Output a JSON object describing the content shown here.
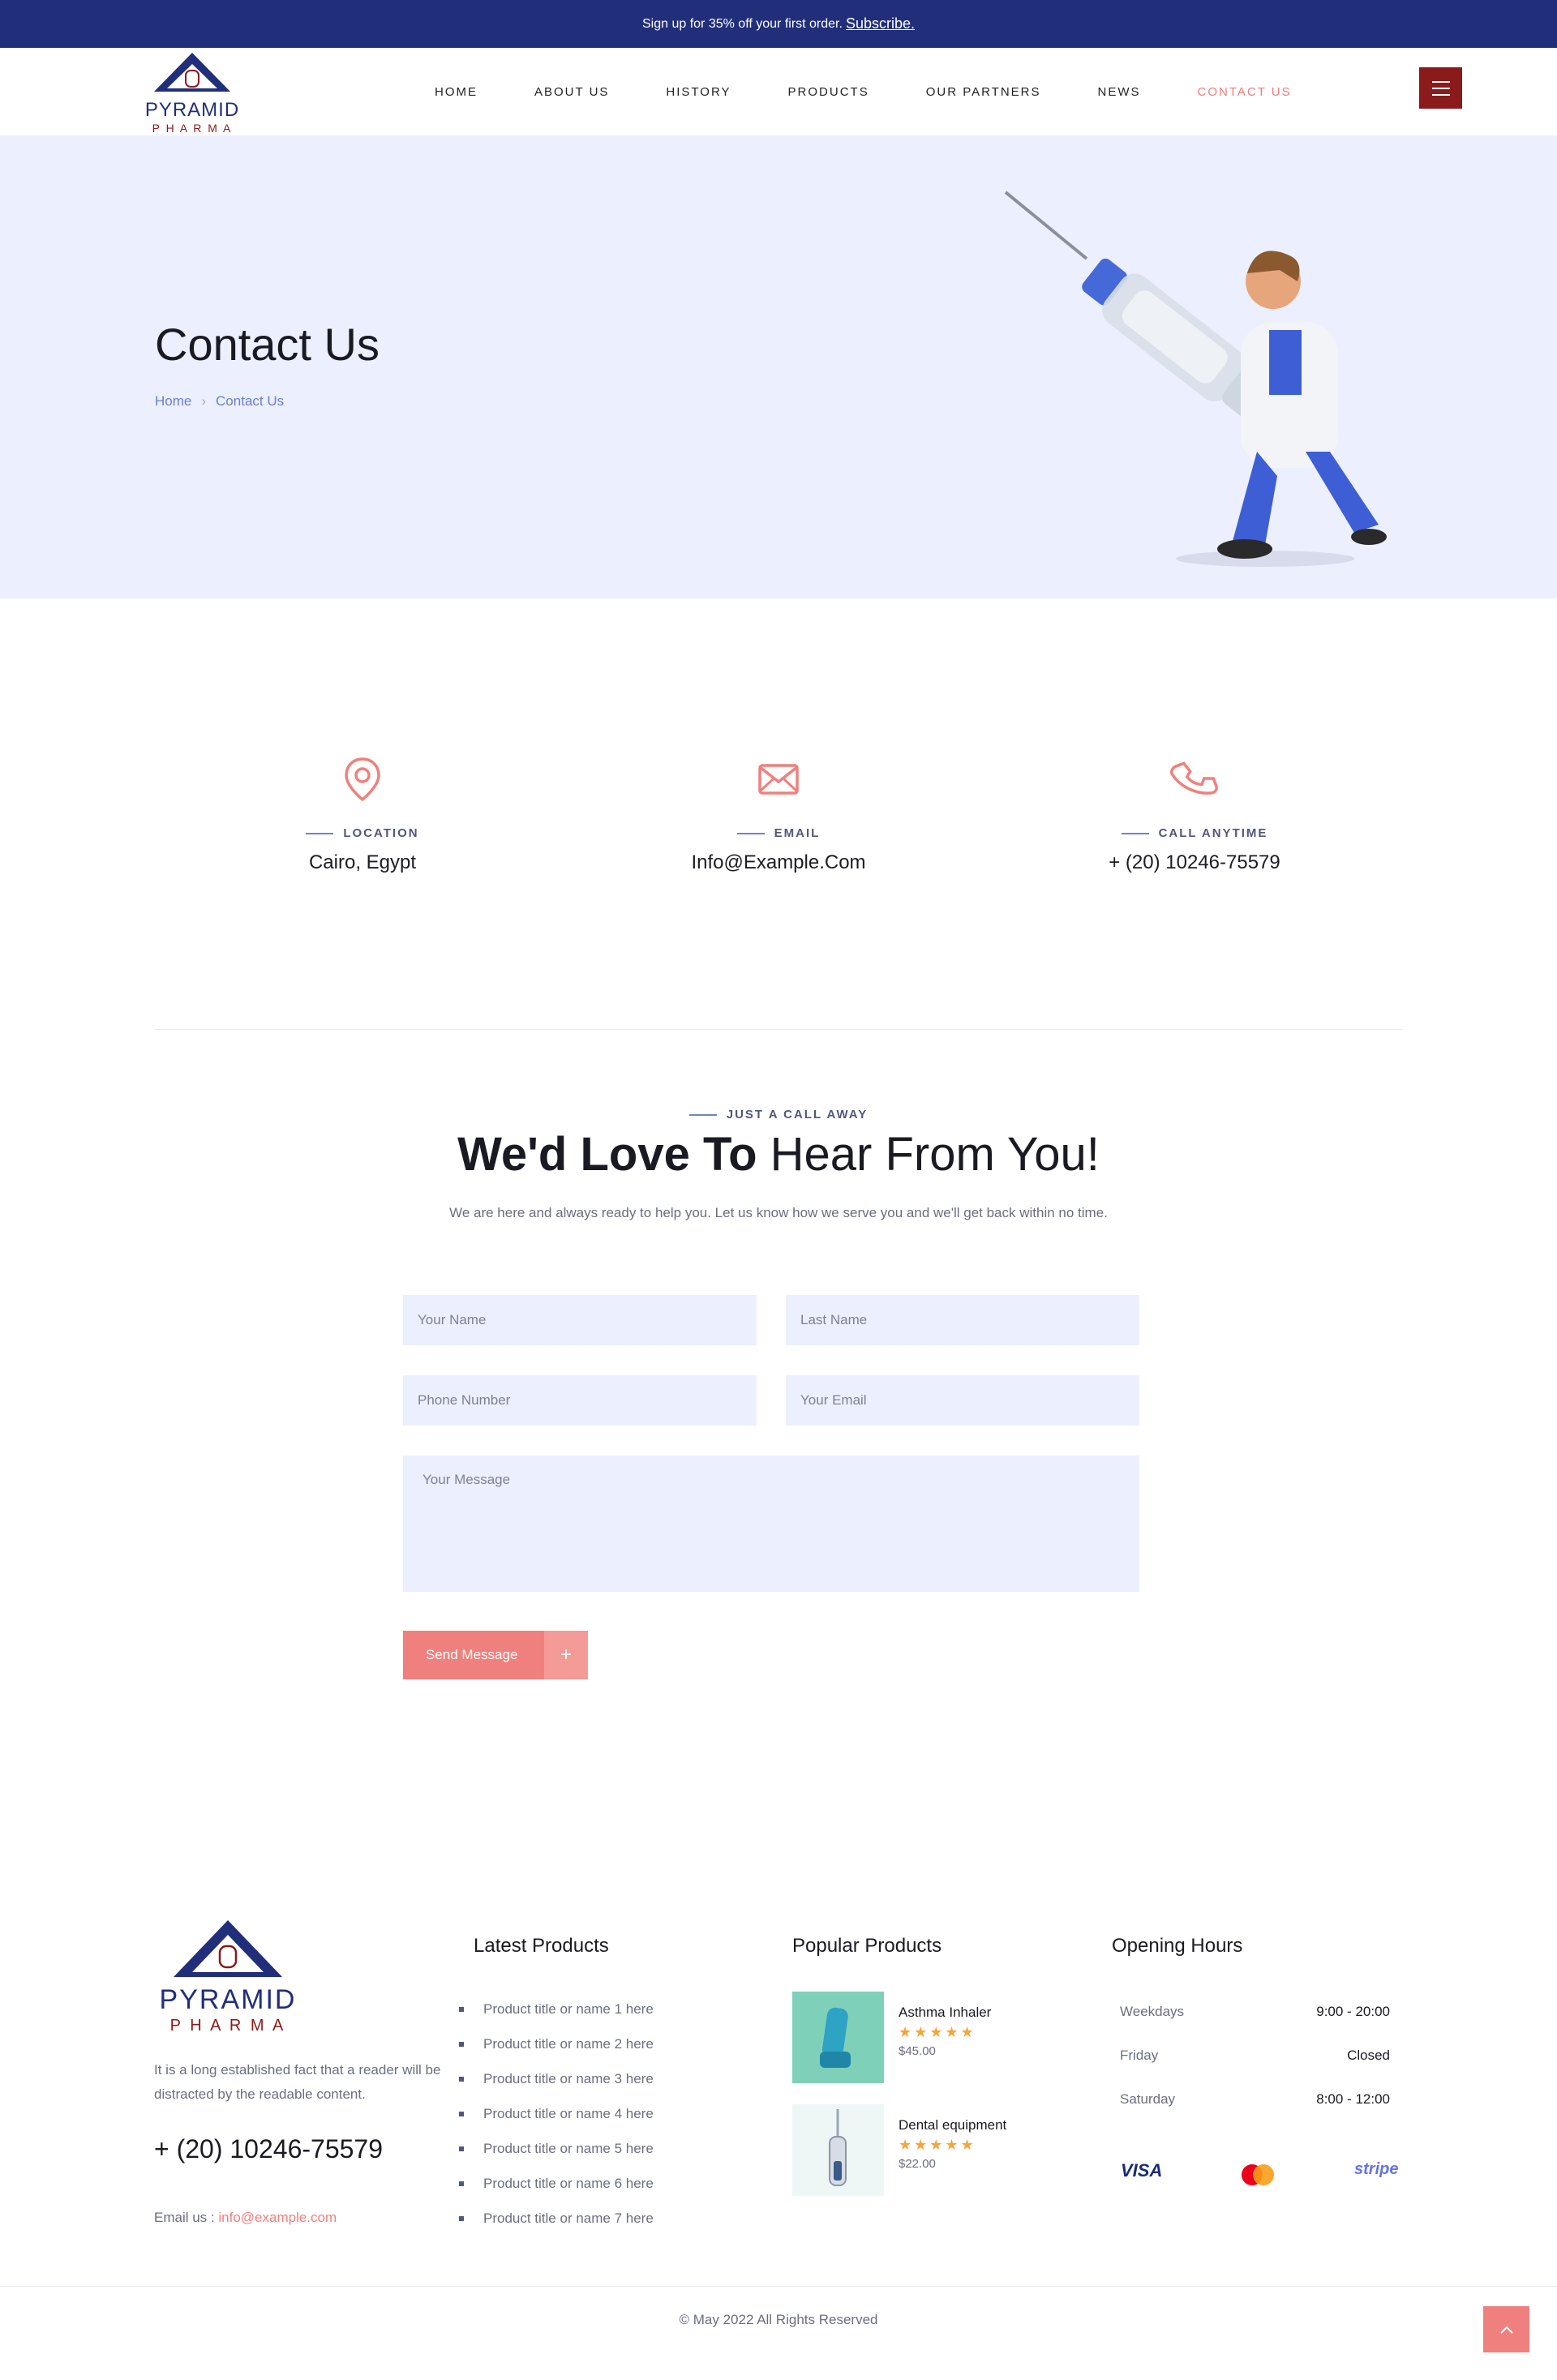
{
  "topbar": {
    "text": "Sign up for 35% off your first order.",
    "link": "Subscribe."
  },
  "brand": {
    "line1": "PYRAMID",
    "line2": "P H A R M A"
  },
  "nav": [
    {
      "label": "HOME"
    },
    {
      "label": "ABOUT US"
    },
    {
      "label": "HISTORY"
    },
    {
      "label": "PRODUCTS"
    },
    {
      "label": "OUR PARTNERS"
    },
    {
      "label": "NEWS"
    },
    {
      "label": "CONTACT US",
      "active": true
    }
  ],
  "hero": {
    "title": "Contact Us",
    "crumb_home": "Home",
    "crumb_current": "Contact Us"
  },
  "info": [
    {
      "icon": "location-pin-icon",
      "label": "LOCATION",
      "value": "Cairo, Egypt"
    },
    {
      "icon": "envelope-icon",
      "label": "EMAIL",
      "value": "Info@Example.Com"
    },
    {
      "icon": "phone-icon",
      "label": "CALL ANYTIME",
      "value": "+ (20) 10246-75579"
    }
  ],
  "contact": {
    "kicker": "JUST A CALL AWAY",
    "heading_bold": "We'd Love To",
    "heading_light": "Hear From You!",
    "subtext": "We are here and always ready to help you. Let us know how we serve you and we'll get back within no time.",
    "ph_first": "Your Name",
    "ph_last": "Last Name",
    "ph_phone": "Phone Number",
    "ph_email": "Your Email",
    "ph_message": "Your Message",
    "send": "Send Message",
    "send_plus": "+"
  },
  "footer": {
    "desc": "It is a long established fact that a reader will be distracted by the readable content.",
    "phone": "+ (20) 10246-75579",
    "email_label": "Email us :",
    "email": "info@example.com",
    "latest_title": "Latest Products",
    "latest": [
      "Product title or name 1 here",
      "Product title or name 2 here",
      "Product title or name 3 here",
      "Product title or name 4 here",
      "Product title or name 5 here",
      "Product title or name 6 here",
      "Product title or name 7 here"
    ],
    "popular_title": "Popular Products",
    "popular": [
      {
        "name": "Asthma Inhaler",
        "stars": "★★★★★",
        "price": "$45.00"
      },
      {
        "name": "Dental equipment",
        "stars": "★★★★★",
        "price": "$22.00"
      }
    ],
    "hours_title": "Opening Hours",
    "hours": [
      {
        "day": "Weekdays",
        "time": "9:00 - 20:00"
      },
      {
        "day": "Friday",
        "time": "Closed"
      },
      {
        "day": "Saturday",
        "time": "8:00 - 12:00"
      }
    ],
    "pay_visa": "VISA",
    "pay_stripe": "stripe",
    "copyright": "© May 2022 All Rights Reserved"
  },
  "colors": {
    "navy": "#212f7b",
    "accent": "#f0807d",
    "menu": "#8b1a1a",
    "hero_bg": "#eceffd"
  }
}
